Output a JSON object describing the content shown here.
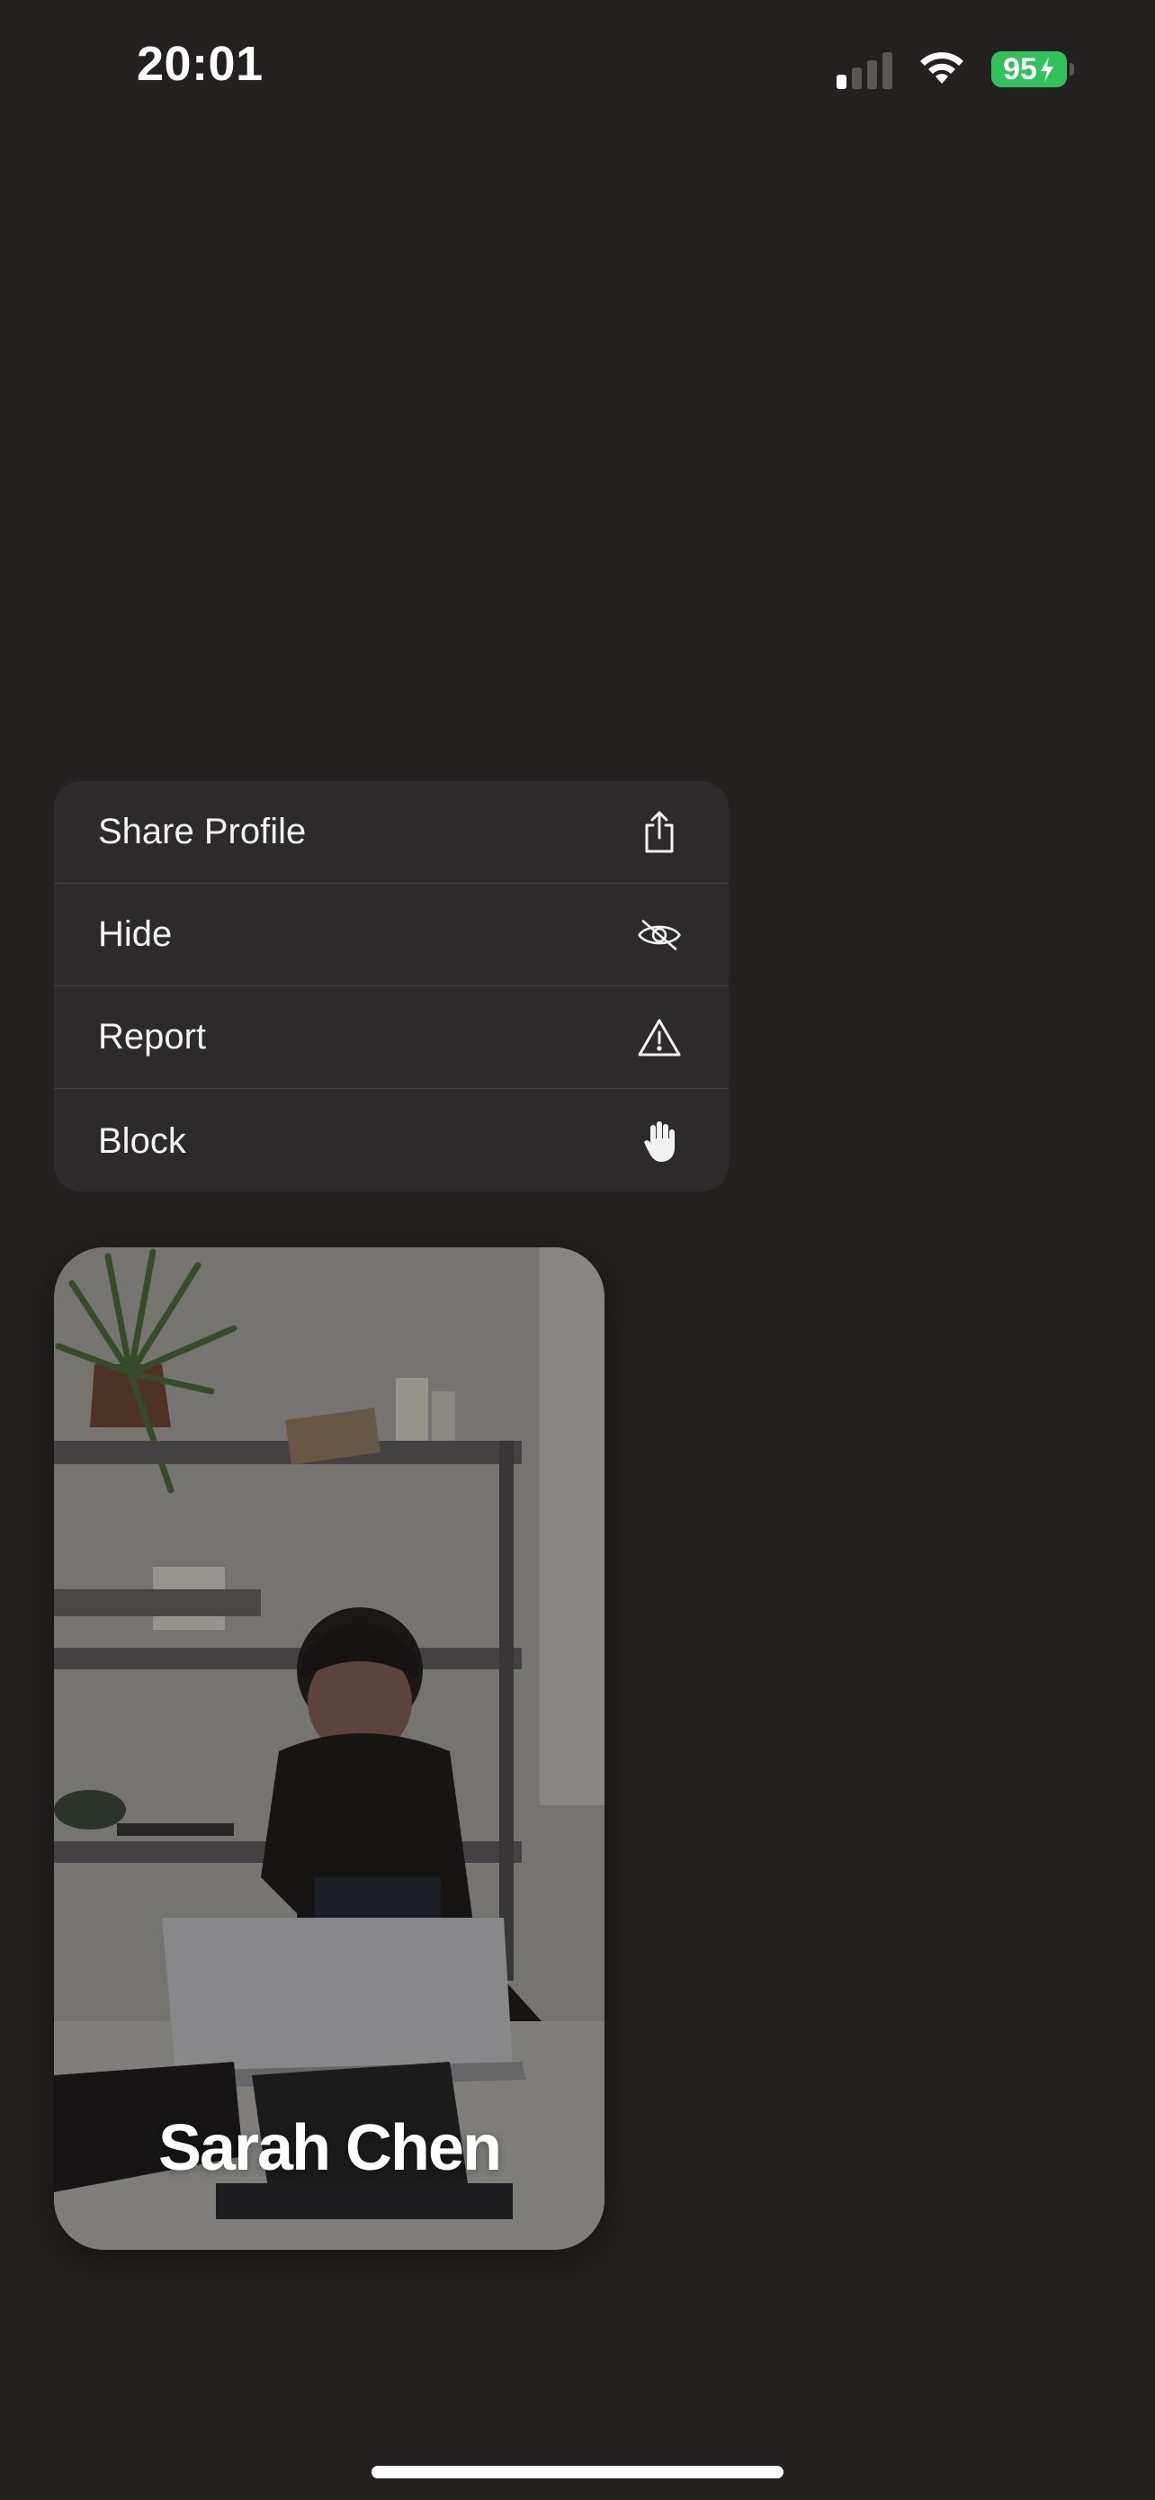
{
  "status_bar": {
    "time": "20:01",
    "battery_level": "95",
    "battery_charging": true,
    "cellular_bars_active": 1,
    "icons": [
      "cellular-signal-icon",
      "wifi-icon",
      "battery-icon",
      "charging-bolt-icon"
    ]
  },
  "context_menu": {
    "items": [
      {
        "label": "Share Profile",
        "icon": "share-icon"
      },
      {
        "label": "Hide",
        "icon": "eye-slash-icon"
      },
      {
        "label": "Report",
        "icon": "warning-triangle-icon"
      },
      {
        "label": "Block",
        "icon": "hand-raised-icon"
      }
    ]
  },
  "profile_card": {
    "name": "Sarah Chen"
  },
  "colors": {
    "background": "#242020",
    "menu_background": "#2d2a2b",
    "battery_green": "#30c35a"
  }
}
